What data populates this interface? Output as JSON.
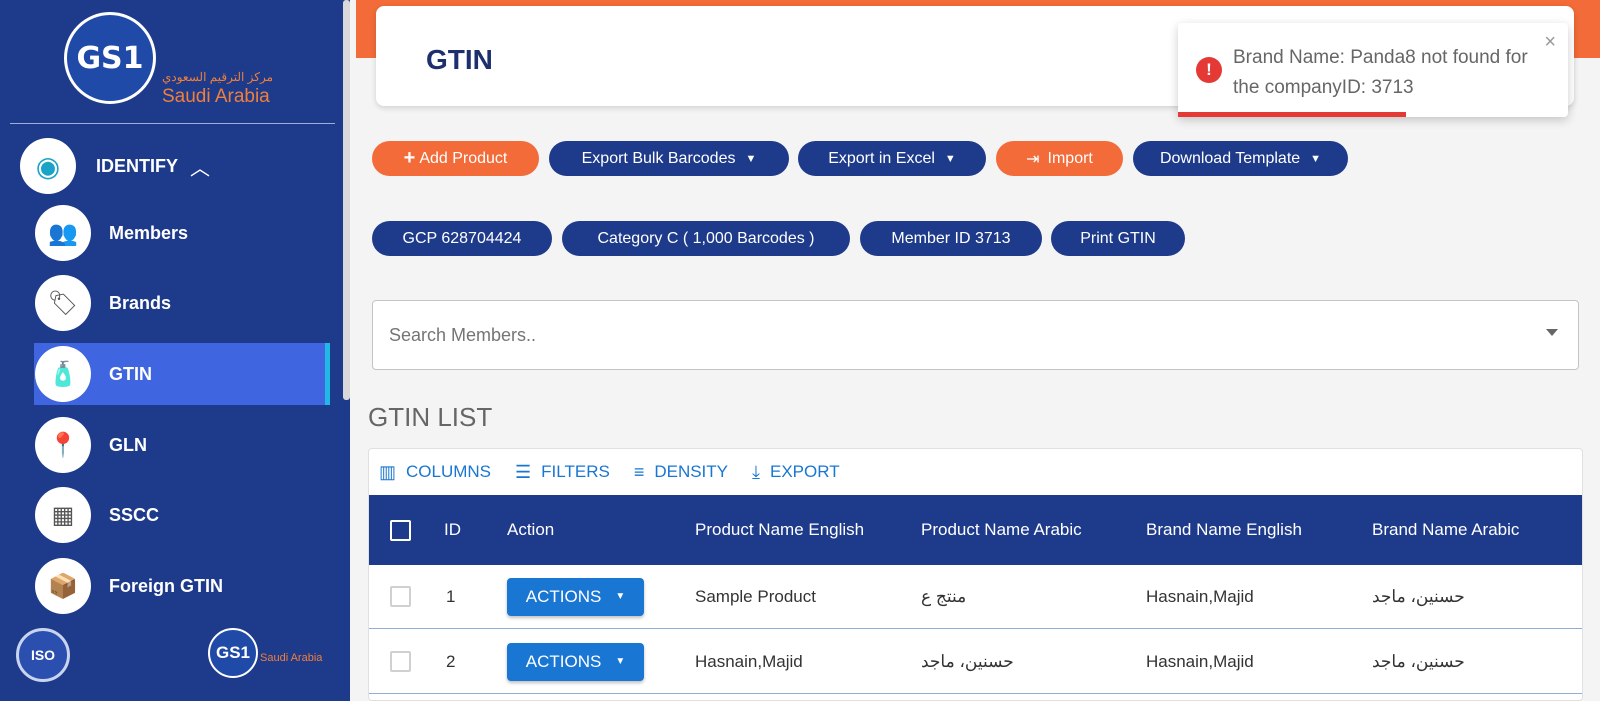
{
  "sidebar": {
    "logo": {
      "mark": "GS1",
      "arabic": "مركز الترقيم السعودي",
      "country": "Saudi Arabia"
    },
    "section": {
      "label": "IDENTIFY",
      "icon": "eye-icon"
    },
    "items": [
      {
        "label": "Members",
        "icon": "members-icon"
      },
      {
        "label": "Brands",
        "icon": "brand-tag-icon"
      },
      {
        "label": "GTIN",
        "icon": "gtin-product-icon"
      },
      {
        "label": "GLN",
        "icon": "location-store-icon"
      },
      {
        "label": "SSCC",
        "icon": "container-icon"
      },
      {
        "label": "Foreign GTIN",
        "icon": "box-icon"
      }
    ],
    "active_item": "GTIN",
    "iso_badge": "ISO",
    "bottom_logo": {
      "mark": "GS1",
      "country": "Saudi Arabia"
    }
  },
  "header": {
    "title": "GTIN"
  },
  "toast": {
    "message": "Brand Name: Panda8 not found for the companyID: 3713",
    "close": "×"
  },
  "actions": {
    "add_product": "Add Product",
    "export_bulk": "Export Bulk Barcodes",
    "export_excel": "Export in Excel",
    "import": "Import",
    "download_template": "Download Template"
  },
  "info": {
    "gcp": "GCP 628704424",
    "category": "Category C ( 1,000 Barcodes )",
    "member_id": "Member ID 3713",
    "print": "Print GTIN"
  },
  "search": {
    "placeholder": "Search Members.."
  },
  "list": {
    "title": "GTIN LIST",
    "toolbar": {
      "columns": "COLUMNS",
      "filters": "FILTERS",
      "density": "DENSITY",
      "export": "EXPORT"
    },
    "columns": [
      "ID",
      "Action",
      "Product Name English",
      "Product Name Arabic",
      "Brand Name English",
      "Brand Name Arabic"
    ],
    "rows": [
      {
        "id": "1",
        "action": "ACTIONS",
        "product_en": "Sample Product",
        "product_ar": "منتج ع",
        "brand_en": "Hasnain,Majid",
        "brand_ar": "حسنين، ماجد"
      },
      {
        "id": "2",
        "action": "ACTIONS",
        "product_en": "Hasnain,Majid",
        "product_ar": "حسنين، ماجد",
        "brand_en": "Hasnain,Majid",
        "brand_ar": "حسنين، ماجد"
      }
    ]
  },
  "colors": {
    "sidebar": "#1e3a8a",
    "accent_orange": "#f26b38",
    "active_item": "#3f65e0",
    "error": "#e53935",
    "link_blue": "#1976d2"
  }
}
